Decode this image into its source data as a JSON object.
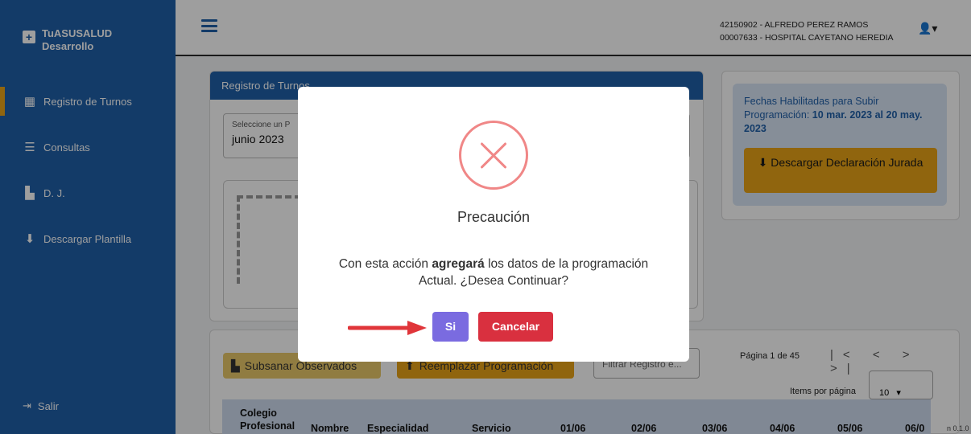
{
  "brand": {
    "line1": "TuASUSALUD",
    "line2": "Desarrollo"
  },
  "sidebar": {
    "items": [
      {
        "label": "Registro de Turnos",
        "icon": "calendar-icon",
        "active": true
      },
      {
        "label": "Consultas",
        "icon": "list-icon",
        "active": false
      },
      {
        "label": "D. J.",
        "icon": "pdf-file-icon",
        "active": false
      },
      {
        "label": "Descargar Plantilla",
        "icon": "download-file-icon",
        "active": false
      }
    ],
    "logout": "Salir"
  },
  "header": {
    "user_line1": "42150902 - ALFREDO PEREZ RAMOS",
    "user_line2": "00007633 - HOSPITAL CAYETANO HEREDIA"
  },
  "main": {
    "card_title": "Registro de Turnos",
    "period_label": "Seleccione un P",
    "period_value": "junio  2023",
    "info_text_prefix": "Fechas Habilitadas para Subir Programación: ",
    "info_text_dates": "10 mar. 2023 al 20 may. 2023",
    "download_label": "Descargar Declaración Jurada",
    "subsanar_label": "Subsanar Observados",
    "reemplazar_label": "Reemplazar Programación",
    "filter_placeholder": "Filtrar Registro e...",
    "pager_text": "Página 1 de 45",
    "items_per_page_label": "Items por página",
    "items_per_page_value": "10",
    "table_headers": [
      "Colegio Profesional",
      "Nombre",
      "Especialidad",
      "Servicio",
      "01/06",
      "02/06",
      "03/06",
      "04/06",
      "05/06",
      "06/0"
    ],
    "version": "n 0.1.0"
  },
  "modal": {
    "title": "Precaución",
    "text_before": "Con esta acción ",
    "text_bold": "agregará",
    "text_after": " los datos de la programación Actual. ¿Desea Continuar?",
    "confirm_label": "Si",
    "cancel_label": "Cancelar"
  },
  "colors": {
    "sidebar": "#1f5fa8",
    "accent": "#e8a317",
    "confirm": "#7a6be0",
    "cancel": "#d9303f",
    "error": "#f08787"
  }
}
